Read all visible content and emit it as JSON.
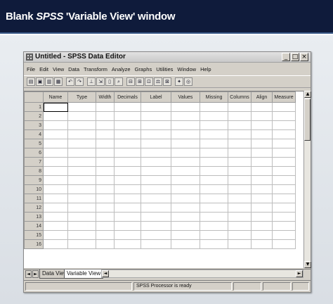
{
  "banner": {
    "prefix": "Blank ",
    "emphasis": "SPSS",
    "suffix": " 'Variable View' window"
  },
  "window": {
    "title": "Untitled - SPSS Data Editor",
    "controls": [
      "_",
      "□",
      "×"
    ]
  },
  "menu": [
    "File",
    "Edit",
    "View",
    "Data",
    "Transform",
    "Analyze",
    "Graphs",
    "Utilities",
    "Window",
    "Help"
  ],
  "toolbar": [
    {
      "name": "open-icon",
      "glyph": "▤"
    },
    {
      "name": "save-icon",
      "glyph": "▣"
    },
    {
      "name": "print-icon",
      "glyph": "▥"
    },
    {
      "name": "dialog-recall-icon",
      "glyph": "▦"
    },
    {
      "name": "undo-icon",
      "glyph": "↶"
    },
    {
      "name": "redo-icon",
      "glyph": "↷"
    },
    {
      "name": "goto-chart-icon",
      "glyph": "⊥"
    },
    {
      "name": "goto-case-icon",
      "glyph": "⇲"
    },
    {
      "name": "variables-icon",
      "glyph": "▯"
    },
    {
      "name": "find-icon",
      "glyph": "⌕"
    },
    {
      "name": "insert-case-icon",
      "glyph": "⊟"
    },
    {
      "name": "insert-variable-icon",
      "glyph": "⊞"
    },
    {
      "name": "split-file-icon",
      "glyph": "⊡"
    },
    {
      "name": "weight-cases-icon",
      "glyph": "⚖"
    },
    {
      "name": "select-cases-icon",
      "glyph": "⊠"
    },
    {
      "name": "value-labels-icon",
      "glyph": "✦"
    },
    {
      "name": "use-sets-icon",
      "glyph": "◎"
    }
  ],
  "grid": {
    "columns": [
      "Name",
      "Type",
      "Width",
      "Decimals",
      "Label",
      "Values",
      "Missing",
      "Columns",
      "Align",
      "Measure"
    ],
    "rows": [
      "1",
      "2",
      "3",
      "4",
      "5",
      "6",
      "7",
      "8",
      "9",
      "10",
      "11",
      "12",
      "13",
      "14",
      "15",
      "16"
    ]
  },
  "tabs": {
    "data_view": "Data View",
    "variable_view": "Variable View"
  },
  "status": {
    "processor": "SPSS Processor  is ready"
  }
}
